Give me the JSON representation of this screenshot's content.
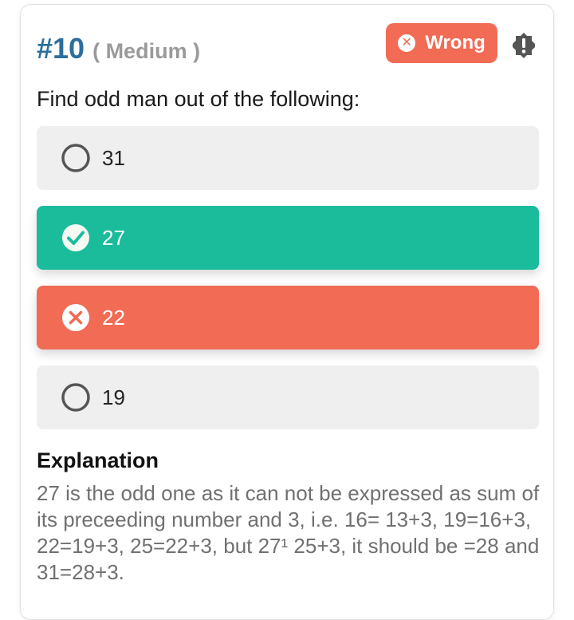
{
  "question": {
    "number": "#10",
    "difficulty": "( Medium )",
    "text": "Find odd man out of the following:"
  },
  "status_badge": {
    "label": "Wrong",
    "color": "#f26b55"
  },
  "report_icon": "alert-octagon-icon",
  "options": [
    {
      "label": "31",
      "state": "unselected",
      "icon": "radio-circle-icon"
    },
    {
      "label": "27",
      "state": "correct",
      "icon": "check-circle-icon",
      "color": "#1abc9c"
    },
    {
      "label": "22",
      "state": "wrong",
      "icon": "x-circle-icon",
      "color": "#f26b55"
    },
    {
      "label": "19",
      "state": "unselected",
      "icon": "radio-circle-icon"
    }
  ],
  "explanation": {
    "title": "Explanation",
    "text": "27 is the odd one as it can not be expressed as sum of its preceeding number and 3, i.e. 16= 13+3, 19=16+3,  22=19+3, 25=22+3, but 27¹ 25+3, it should be =28 and 31=28+3."
  },
  "colors": {
    "accent": "#2a6f9e",
    "correct": "#1abc9c",
    "wrong": "#f26b55",
    "neutral": "#efefef"
  }
}
